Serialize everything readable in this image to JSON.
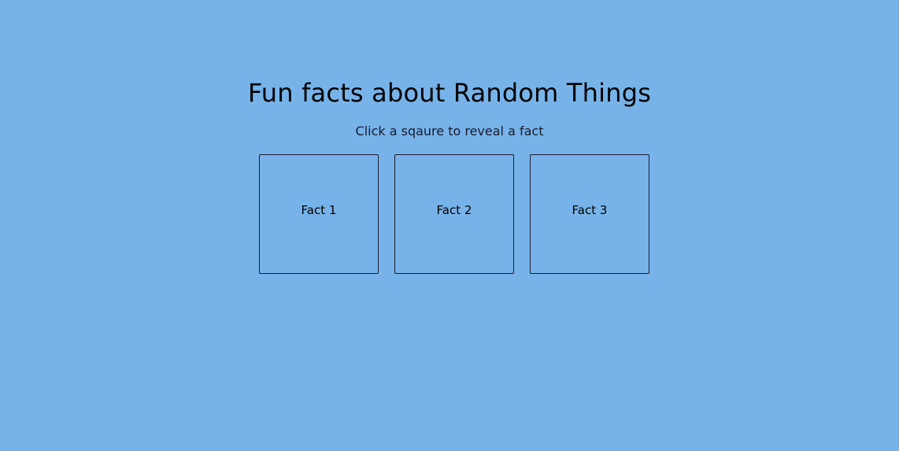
{
  "page": {
    "title": "Fun facts about Random Things",
    "subtitle": "Click a sqaure to reveal a fact"
  },
  "facts": [
    {
      "label": "Fact 1"
    },
    {
      "label": "Fact 2"
    },
    {
      "label": "Fact 3"
    }
  ],
  "colors": {
    "background": "#77b3e9",
    "border": "#1c1c30",
    "text": "#000000"
  }
}
